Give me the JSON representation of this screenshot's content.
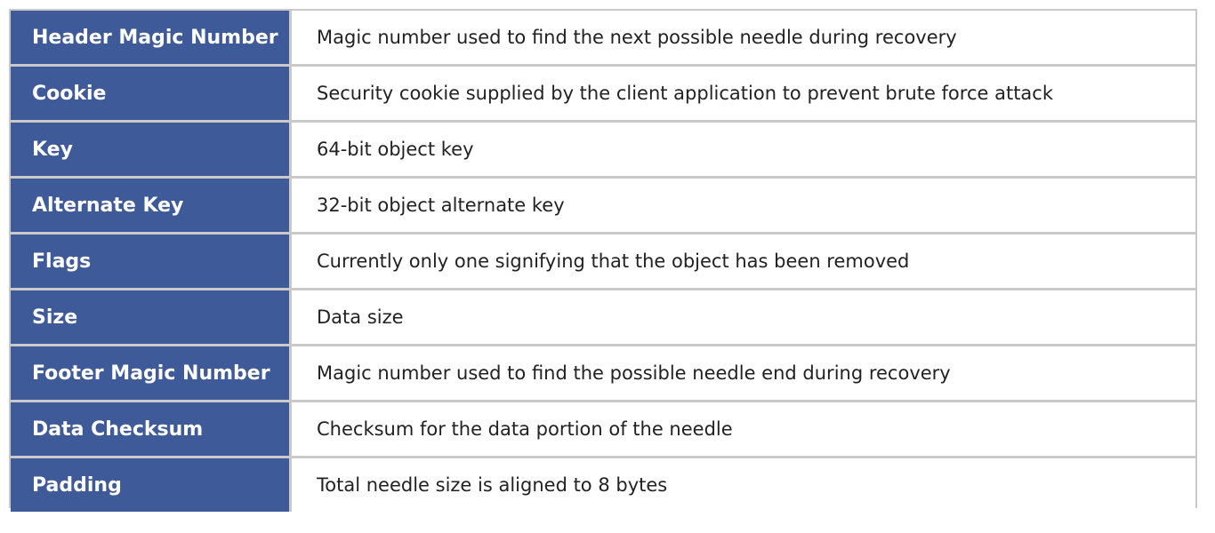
{
  "rows": [
    {
      "name": "Header Magic Number",
      "description": "Magic number used to find the next possible needle during recovery"
    },
    {
      "name": "Cookie",
      "description": "Security cookie supplied by the client application to prevent brute force attack"
    },
    {
      "name": "Key",
      "description": "64-bit object key"
    },
    {
      "name": "Alternate Key",
      "description": "32-bit object alternate key"
    },
    {
      "name": "Flags",
      "description": "Currently only one signifying that the object has been removed"
    },
    {
      "name": "Size",
      "description": "Data size"
    },
    {
      "name": "Footer Magic Number",
      "description": "Magic number used to find the possible needle end during recovery"
    },
    {
      "name": "Data Checksum",
      "description": "Checksum for the data portion of the needle"
    },
    {
      "name": "Padding",
      "description": "Total needle size is aligned to 8 bytes"
    }
  ],
  "colors": {
    "label_background": "#3f5a99",
    "label_text": "#ffffff",
    "description_background": "#ffffff",
    "border": "#c9c9c9"
  }
}
